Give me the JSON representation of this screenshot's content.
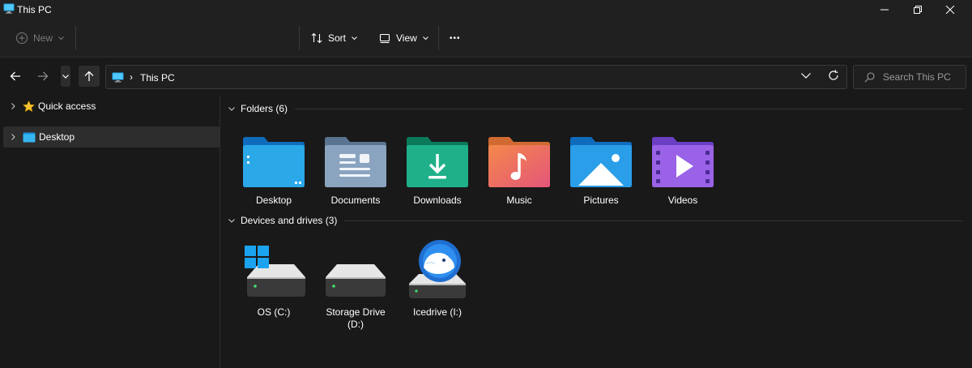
{
  "window": {
    "title": "This PC"
  },
  "toolbar": {
    "new_label": "New",
    "sort_label": "Sort",
    "view_label": "View",
    "more_label": "•••"
  },
  "address": {
    "separator": "›",
    "current": "This PC"
  },
  "search": {
    "placeholder": "Search This PC"
  },
  "sidebar": {
    "items": [
      {
        "label": "Quick access",
        "icon": "star-icon"
      },
      {
        "label": "Desktop",
        "icon": "desktop-folder-icon",
        "selected": true
      }
    ]
  },
  "content": {
    "folders_header": "Folders (6)",
    "drives_header": "Devices and drives (3)",
    "folders": [
      {
        "label": "Desktop",
        "icon": "desktop-folder-icon"
      },
      {
        "label": "Documents",
        "icon": "documents-folder-icon"
      },
      {
        "label": "Downloads",
        "icon": "downloads-folder-icon"
      },
      {
        "label": "Music",
        "icon": "music-folder-icon"
      },
      {
        "label": "Pictures",
        "icon": "pictures-folder-icon"
      },
      {
        "label": "Videos",
        "icon": "videos-folder-icon"
      }
    ],
    "drives": [
      {
        "label": "OS (C:)",
        "icon": "windows-drive-icon"
      },
      {
        "label": "Storage Drive (D:)",
        "icon": "hard-drive-icon"
      },
      {
        "label": "Icedrive (I:)",
        "icon": "icedrive-drive-icon"
      }
    ]
  },
  "colors": {
    "background": "#191919",
    "chrome": "#202020",
    "selection": "#2d2d2d",
    "text": "#ffffff",
    "muted_text": "#9a9a9a"
  }
}
